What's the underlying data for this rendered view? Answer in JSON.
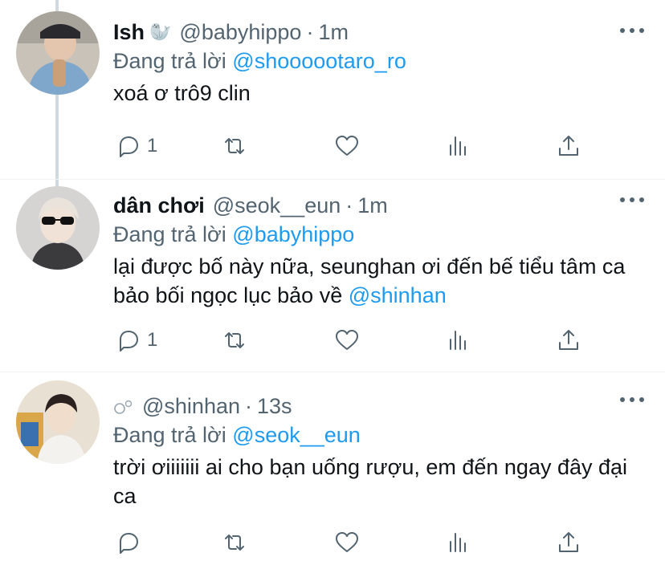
{
  "tweets": [
    {
      "name": "Ish",
      "emoji_icon": "seal-icon",
      "emoji": "🦭",
      "handle": "@babyhippo",
      "time": "1m",
      "reply_prefix": "Đang trả lời",
      "reply_to": "@shoooootaro_ro",
      "text": "xoá ơ trô9 clin",
      "text_mention": "",
      "reply_count": "1"
    },
    {
      "name": "dân chơi",
      "emoji_icon": "",
      "emoji": "",
      "handle": "@seok__eun",
      "time": "1m",
      "reply_prefix": "Đang trả lời",
      "reply_to": "@babyhippo",
      "text": "lại được bố này nữa, seunghan ơi đến bế tiểu tâm ca bảo bối ngọc lục bảo về",
      "text_mention": "@shinhan",
      "reply_count": "1"
    },
    {
      "name": "",
      "emoji_icon": "bubbles-icon",
      "emoji": "°",
      "handle": "@shinhan",
      "time": "13s",
      "reply_prefix": "Đang trả lời",
      "reply_to": "@seok__eun",
      "text": "trời ơiiiiiii ai cho bạn uống rượu, em đến ngay đây đại ca",
      "text_mention": "",
      "reply_count": ""
    }
  ],
  "separator": "·",
  "colors": {
    "accent": "#1d9bf0",
    "muted": "#536471",
    "text": "#0f1419",
    "thread_line": "#cfd9de"
  }
}
